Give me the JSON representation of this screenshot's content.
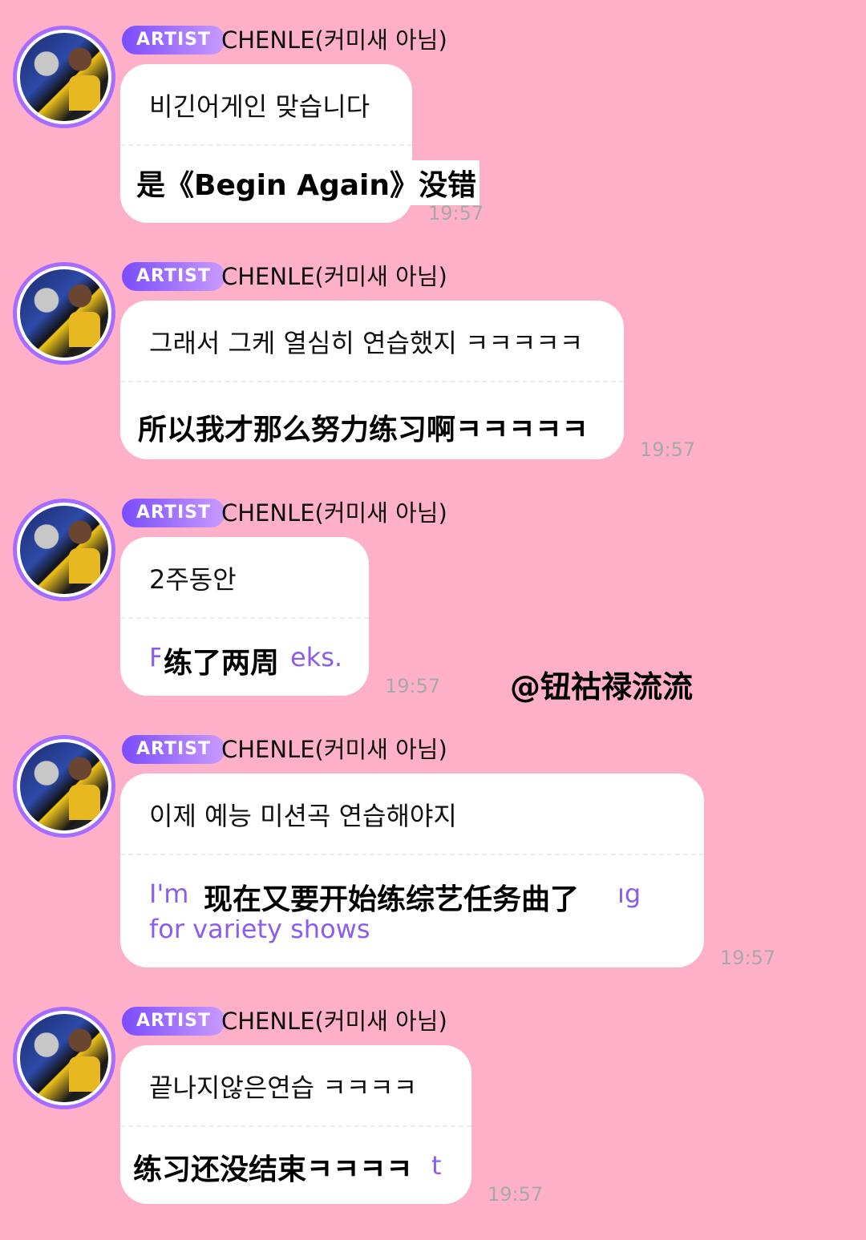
{
  "watermark": "@钮祜禄流流",
  "messages": [
    {
      "badge": "ARTIST",
      "sender": "CHENLE(커미새 아님)",
      "korean": "비긴어게인 맞습니다",
      "english": "",
      "chinese": "是《Begin Again》没错",
      "time": "19:57"
    },
    {
      "badge": "ARTIST",
      "sender": "CHENLE(커미새 아님)",
      "korean": "그래서 그케 열심히 연습했지 ㅋㅋㅋㅋㅋ",
      "english": "",
      "chinese": "所以我才那么努力练习啊ㅋㅋㅋㅋㅋ",
      "time": "19:57"
    },
    {
      "badge": "ARTIST",
      "sender": "CHENLE(커미새 아님)",
      "korean": "2주동안",
      "english_pre": "F",
      "english_post": "eks.",
      "chinese": "练了两周",
      "time": "19:57"
    },
    {
      "badge": "ARTIST",
      "sender": "CHENLE(커미새 아님)",
      "korean": "이제 예능 미션곡 연습해야지",
      "english_pre": "I'm",
      "english_post": "ıg",
      "english_line2": "for variety shows",
      "chinese": "现在又要开始练综艺任务曲了",
      "time": "19:57"
    },
    {
      "badge": "ARTIST",
      "sender": "CHENLE(커미새 아님)",
      "korean": "끝나지않은연습 ㅋㅋㅋㅋ",
      "english_post": "t",
      "chinese": "练习还没结束ㅋㅋㅋㅋ",
      "time": "19:57"
    }
  ]
}
